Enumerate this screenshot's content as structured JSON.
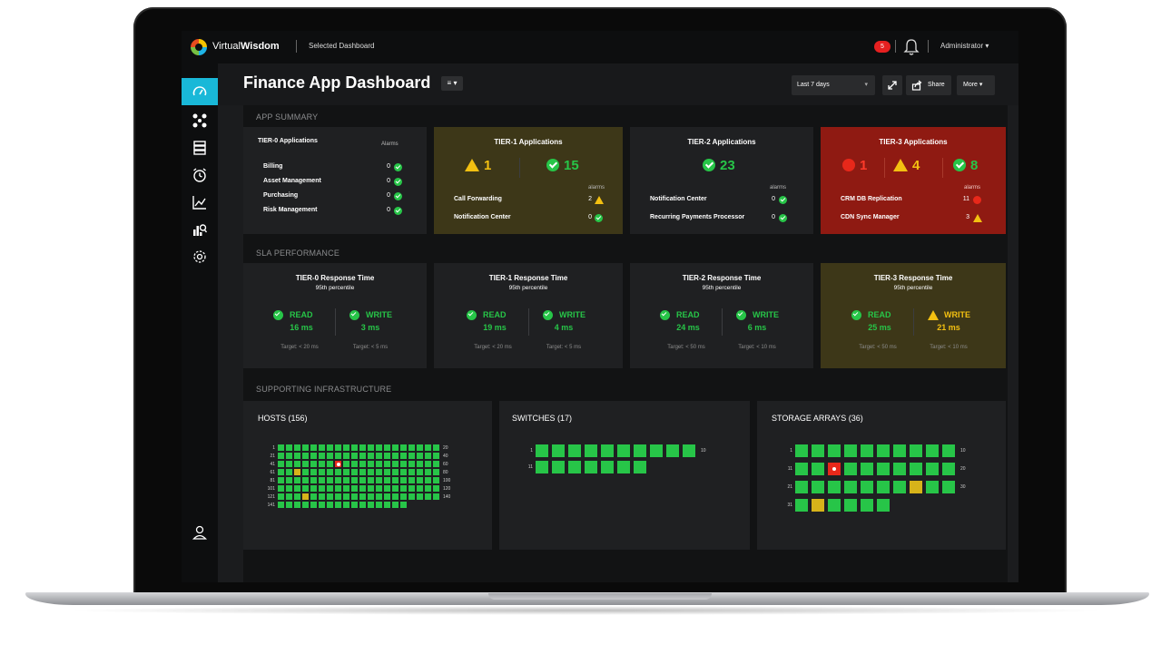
{
  "topbar": {
    "brand_light": "Virtual",
    "brand_bold": "Wisdom",
    "breadcrumb": "Selected Dashboard",
    "notification_count": "5",
    "user": "Administrator ▾"
  },
  "header": {
    "title": "Finance App Dashboard",
    "list_button": "≡ ▾",
    "time_range": "Last 7 days",
    "time_range_caret": "▾",
    "share_label": "Share",
    "more_label": "More ▾"
  },
  "sections": {
    "app_summary": "APP SUMMARY",
    "sla": "SLA PERFORMANCE",
    "infra": "SUPPORTING INFRASTRUCTURE"
  },
  "tier0": {
    "title": "TIER-0 Applications",
    "alarms_label": "Alarms",
    "rows": [
      {
        "name": "Billing",
        "value": "0"
      },
      {
        "name": "Asset Management",
        "value": "0"
      },
      {
        "name": "Purchasing",
        "value": "0"
      },
      {
        "name": "Risk Management",
        "value": "0"
      }
    ]
  },
  "tier1": {
    "title": "TIER-1 Applications",
    "warn_count": "1",
    "ok_count": "15",
    "alarms_label": "alarms",
    "rows": [
      {
        "name": "Call Forwarding",
        "value": "2"
      },
      {
        "name": "Notification Center",
        "value": "0"
      }
    ]
  },
  "tier2": {
    "title": "TIER-2 Applications",
    "ok_count": "23",
    "alarms_label": "alarms",
    "rows": [
      {
        "name": "Notification Center",
        "value": "0"
      },
      {
        "name": "Recurring Payments Processor",
        "value": "0"
      }
    ]
  },
  "tier3": {
    "title": "TIER-3 Applications",
    "err_count": "1",
    "warn_count": "4",
    "ok_count": "8",
    "alarms_label": "alarms",
    "rows": [
      {
        "name": "CRM DB Replication",
        "value": "11"
      },
      {
        "name": "CDN Sync Manager",
        "value": "3"
      }
    ]
  },
  "sla": [
    {
      "title": "TIER-0 Response Time",
      "subtitle": "95th percentile",
      "read_label": "READ",
      "read": "16 ms",
      "write_label": "WRITE",
      "write": "3 ms",
      "read_target": "Target: < 20 ms",
      "write_target": "Target: < 5 ms"
    },
    {
      "title": "TIER-1 Response Time",
      "subtitle": "95th percentile",
      "read_label": "READ",
      "read": "19 ms",
      "write_label": "WRITE",
      "write": "4 ms",
      "read_target": "Target: < 20 ms",
      "write_target": "Target: < 5 ms"
    },
    {
      "title": "TIER-2 Response Time",
      "subtitle": "95th percentile",
      "read_label": "READ",
      "read": "24 ms",
      "write_label": "WRITE",
      "write": "6 ms",
      "read_target": "Target: < 50 ms",
      "write_target": "Target: < 10 ms"
    },
    {
      "title": "TIER-3 Response Time",
      "subtitle": "95th percentile",
      "read_label": "READ",
      "read": "25 ms",
      "write_label": "WRITE",
      "write": "21 ms",
      "read_target": "Target: < 50 ms",
      "write_target": "Target: < 10 ms"
    }
  ],
  "infra": {
    "hosts": {
      "title": "HOSTS (156)",
      "count": 156,
      "per_row": 20,
      "row_starts": [
        "1",
        "21",
        "41",
        "61",
        "81",
        "101",
        "121",
        "141"
      ],
      "row_ends": [
        "20",
        "40",
        "60",
        "80",
        "100",
        "120",
        "140",
        ""
      ],
      "status": {
        "48": "red",
        "63": "yellow",
        "124": "yellow"
      }
    },
    "switches": {
      "title": "SWITCHES (17)",
      "count": 17,
      "per_row": 10,
      "row_starts": [
        "1",
        "11"
      ],
      "row_ends": [
        "10",
        ""
      ],
      "status": {}
    },
    "arrays": {
      "title": "STORAGE ARRAYS (36)",
      "count": 36,
      "per_row": 10,
      "row_starts": [
        "1",
        "11",
        "21",
        "31"
      ],
      "row_ends": [
        "10",
        "20",
        "30",
        ""
      ],
      "status": {
        "13": "red",
        "28": "yellow",
        "32": "yellow"
      }
    }
  },
  "colors": {
    "accent": "#19b8d8",
    "ok": "#27c548",
    "warn": "#f3c011",
    "err": "#e8281a",
    "tier_warn_bg": "#3d3718",
    "tier_err_bg": "#8f1a12"
  }
}
